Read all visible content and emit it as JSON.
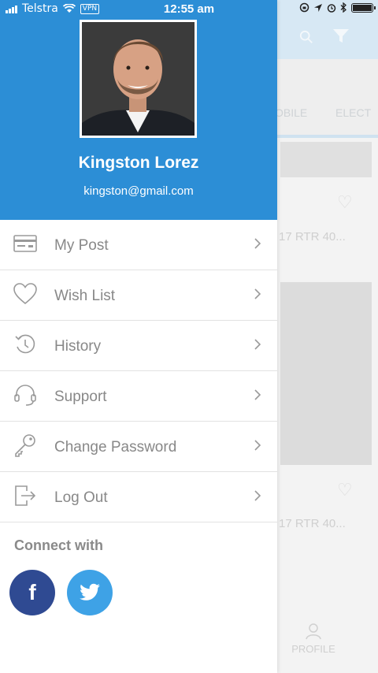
{
  "status_bar": {
    "carrier": "Telstra",
    "vpn": "VPN",
    "time": "12:55 am"
  },
  "profile": {
    "name": "Kingston Lorez",
    "email": "kingston@gmail.com"
  },
  "menu": {
    "items": [
      {
        "label": "My Post",
        "icon": "card-icon"
      },
      {
        "label": "Wish List",
        "icon": "heart-icon"
      },
      {
        "label": "History",
        "icon": "history-icon"
      },
      {
        "label": "Support",
        "icon": "headset-icon"
      },
      {
        "label": "Change Password",
        "icon": "key-icon"
      },
      {
        "label": "Log Out",
        "icon": "logout-icon"
      }
    ]
  },
  "connect": {
    "title": "Connect with",
    "facebook_label": "f"
  },
  "background": {
    "category_1": "OBILE",
    "category_2": "ELECT",
    "listing_1": "17 RTR 40...",
    "listing_2": "17 RTR 40...",
    "tab_profile": "PROFILE"
  },
  "colors": {
    "header_blue": "#2c8ed6",
    "facebook": "#2f4a92",
    "twitter": "#3ea2e6"
  }
}
